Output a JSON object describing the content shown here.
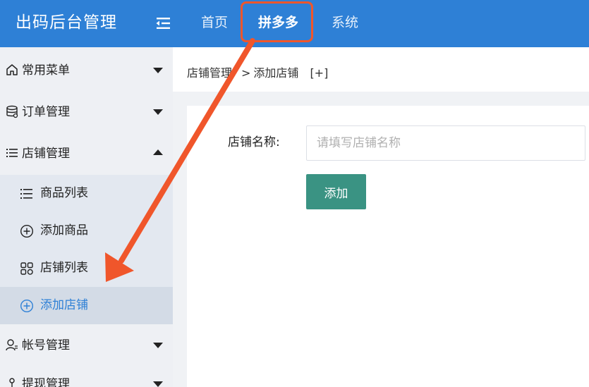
{
  "app": {
    "title": "出码后台管理"
  },
  "topnav": {
    "items": [
      {
        "label": "首页"
      },
      {
        "label": "拼多多"
      },
      {
        "label": "系统"
      }
    ]
  },
  "sidebar": {
    "groups": [
      {
        "label": "常用菜单",
        "icon": "home-icon",
        "expanded": false
      },
      {
        "label": "订单管理",
        "icon": "database-icon",
        "expanded": false
      },
      {
        "label": "店铺管理",
        "icon": "list-icon",
        "expanded": true
      },
      {
        "label": "帐号管理",
        "icon": "user-icon",
        "expanded": false
      },
      {
        "label": "提现管理",
        "icon": "pin-icon",
        "expanded": false
      }
    ],
    "subitems": [
      {
        "label": "商品列表",
        "icon": "list-icon"
      },
      {
        "label": "添加商品",
        "icon": "plus-circle-icon"
      },
      {
        "label": "店铺列表",
        "icon": "grid-icon"
      },
      {
        "label": "添加店铺",
        "icon": "plus-circle-icon",
        "selected": true
      }
    ]
  },
  "breadcrumb": {
    "parent": "店铺管理",
    "separator": ">",
    "current": "添加店铺",
    "add": "[+]"
  },
  "form": {
    "shop_name_label": "店铺名称:",
    "shop_name_placeholder": "请填写店铺名称",
    "shop_name_value": "",
    "submit_label": "添加"
  },
  "colors": {
    "topbar": "#2e80d6",
    "accent": "#2e80d6",
    "button": "#3a9383",
    "annotation": "#f0562b"
  }
}
